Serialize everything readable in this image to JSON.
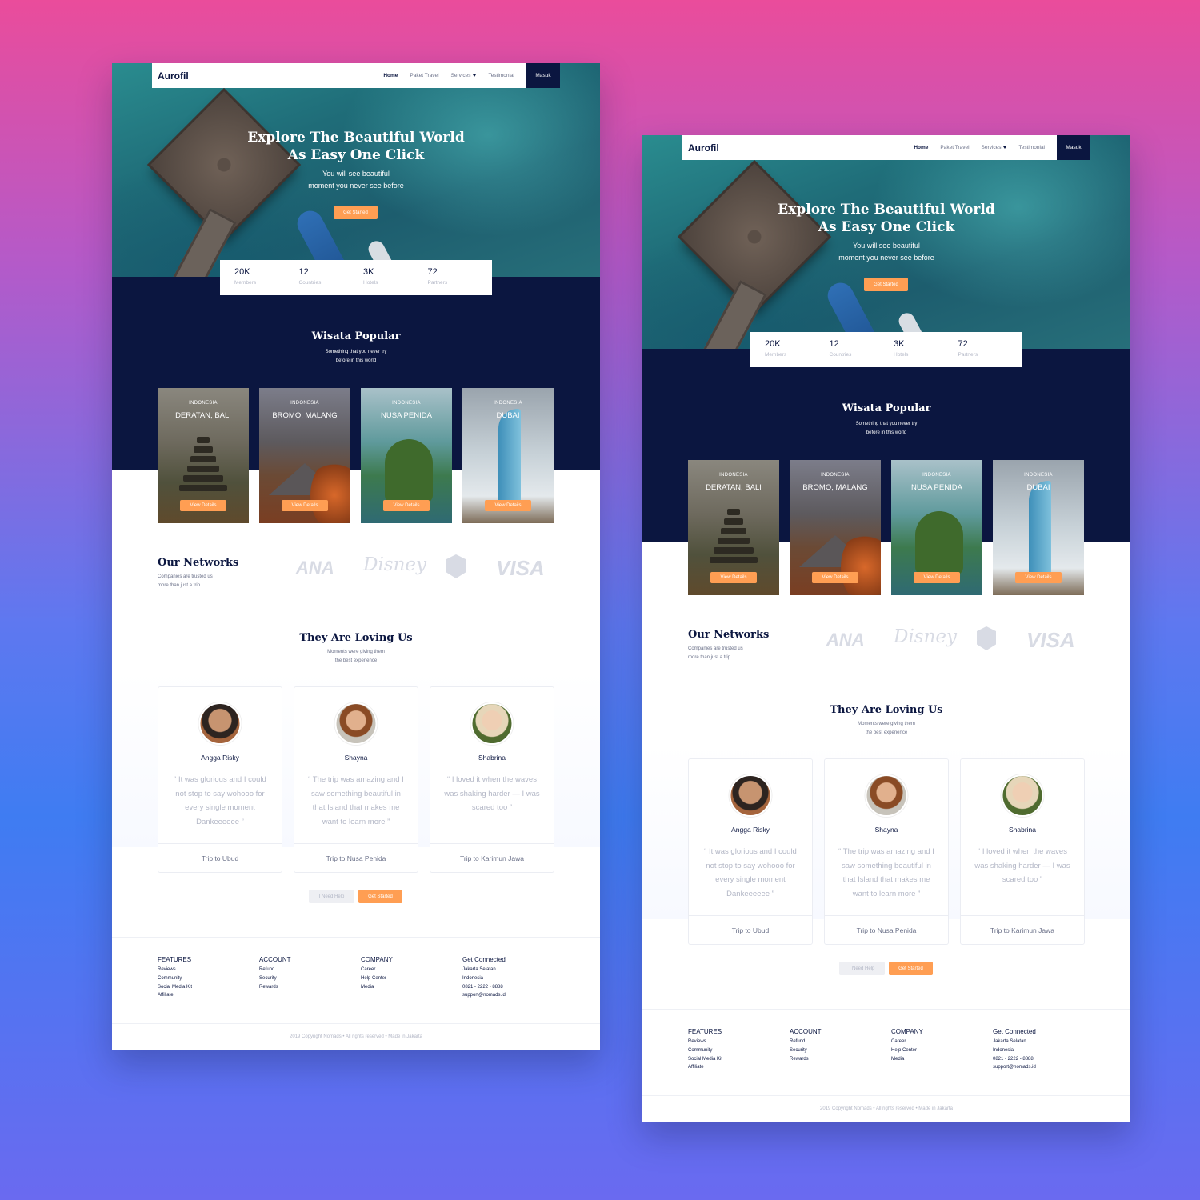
{
  "brand": "Aurofil",
  "nav": {
    "items": [
      "Home",
      "Paket Travel",
      "Services",
      "Testimonial"
    ],
    "login": "Masuk"
  },
  "hero": {
    "title_line1": "Explore The Beautiful World",
    "title_line2": "As Easy One Click",
    "sub_line1": "You will see beautiful",
    "sub_line2": "moment you never see before",
    "cta": "Get Started"
  },
  "stats": [
    {
      "value": "20K",
      "label": "Members"
    },
    {
      "value": "12",
      "label": "Countries"
    },
    {
      "value": "3K",
      "label": "Hotels"
    },
    {
      "value": "72",
      "label": "Partners"
    }
  ],
  "popular": {
    "title": "Wisata Popular",
    "sub_line1": "Something that you never try",
    "sub_line2": "before in this world",
    "cards": [
      {
        "country": "INDONESIA",
        "place": "DERATAN, BALI",
        "button": "View Details"
      },
      {
        "country": "INDONESIA",
        "place": "BROMO, MALANG",
        "button": "View Details"
      },
      {
        "country": "INDONESIA",
        "place": "NUSA PENIDA",
        "button": "View Details"
      },
      {
        "country": "INDONESIA",
        "place": "DUBAI",
        "button": "View Details"
      }
    ]
  },
  "networks": {
    "title": "Our Networks",
    "sub_line1": "Companies are trusted us",
    "sub_line2": "more than just a trip",
    "logos": [
      "ANA",
      "Disney",
      "shield-logo",
      "VISA"
    ]
  },
  "testimonials": {
    "title": "They Are Loving Us",
    "sub_line1": "Moments were giving them",
    "sub_line2": "the best experience",
    "items": [
      {
        "name": "Angga Risky",
        "quote": "“ It was glorious and I could not stop to say wohooo for every single moment Dankeeeeee ”",
        "trip": "Trip to Ubud"
      },
      {
        "name": "Shayna",
        "quote": "“ The trip was amazing and I saw something beautiful in that Island that makes me want to learn more ”",
        "trip": "Trip to Nusa Penida"
      },
      {
        "name": "Shabrina",
        "quote": "“ I loved it when the waves was shaking harder — I was scared too ”",
        "trip": "Trip to Karimun Jawa"
      }
    ],
    "help_button": "I Need Help",
    "start_button": "Get Started"
  },
  "footer": {
    "columns": [
      {
        "title": "FEATURES",
        "items": [
          "Reviews",
          "Community",
          "Social Media Kit",
          "Affiliate"
        ]
      },
      {
        "title": "ACCOUNT",
        "items": [
          "Refund",
          "Security",
          "Rewards"
        ]
      },
      {
        "title": "COMPANY",
        "items": [
          "Career",
          "Help Center",
          "Media"
        ]
      },
      {
        "title": "Get Connected",
        "items": [
          "Jakarta Selatan",
          "Indonesia",
          "0821 - 2222 - 8888",
          "support@nomads.id"
        ]
      }
    ],
    "copyright": "2019 Copyright Nomads • All rights reserved • Made in Jakarta"
  },
  "colors": {
    "navy": "#0b1640",
    "accent": "#ff9e53",
    "muted": "#b3b7c6"
  }
}
